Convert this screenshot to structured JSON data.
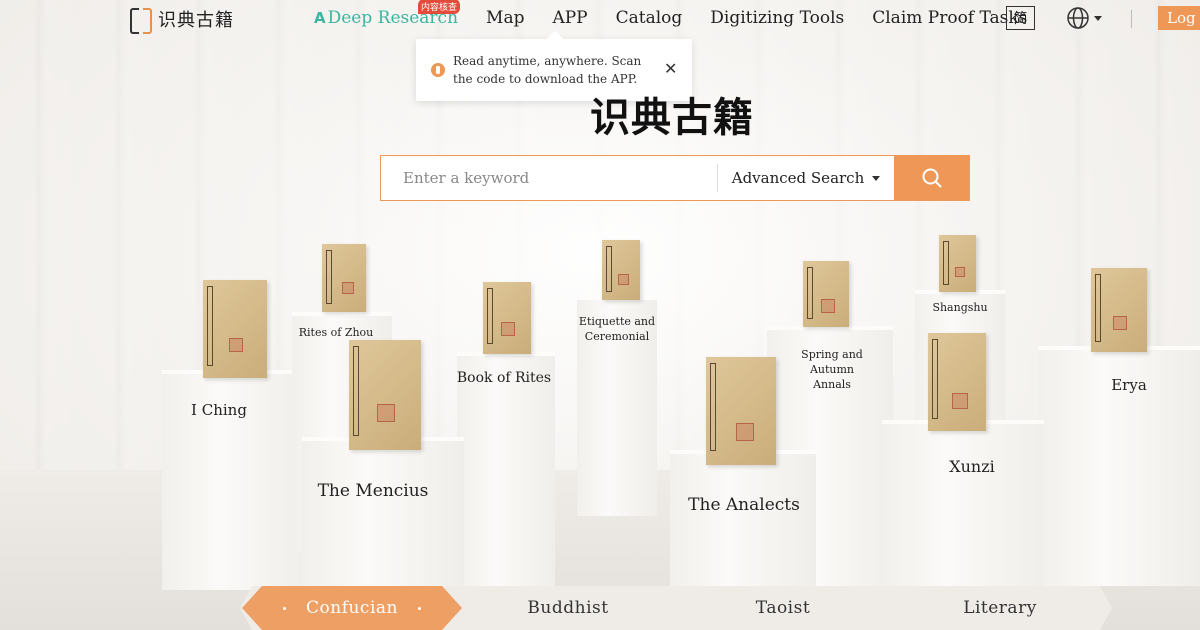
{
  "header": {
    "logo_text": "识典古籍",
    "nav": [
      {
        "label": "Deep Research",
        "badge": "内容核查"
      },
      {
        "label": "Map"
      },
      {
        "label": "APP"
      },
      {
        "label": "Catalog"
      },
      {
        "label": "Digitizing Tools"
      },
      {
        "label": "Claim Proof Tasks"
      }
    ],
    "lang_label": "简",
    "login_label": "Log I"
  },
  "popup": {
    "text": "Read anytime, anywhere. Scan the code to download the APP.",
    "close": "✕"
  },
  "site_title": "识典古籍",
  "search": {
    "placeholder": "Enter a keyword",
    "advanced_label": "Advanced Search"
  },
  "books": [
    {
      "title": "I Ching"
    },
    {
      "title": "Rites of Zhou"
    },
    {
      "title": "The Mencius"
    },
    {
      "title": "Book of Rites"
    },
    {
      "title": "Etiquette and Ceremonial"
    },
    {
      "title": "The Analects"
    },
    {
      "title": "Spring and Autumn Annals"
    },
    {
      "title": "Shangshu"
    },
    {
      "title": "Xunzi"
    },
    {
      "title": "Erya"
    }
  ],
  "tabs": [
    "Confucian",
    "Buddhist",
    "Taoist",
    "Literary"
  ],
  "colors": {
    "accent": "#ee9756",
    "deep_research": "#3ab5a0",
    "badge": "#e64a3a"
  }
}
